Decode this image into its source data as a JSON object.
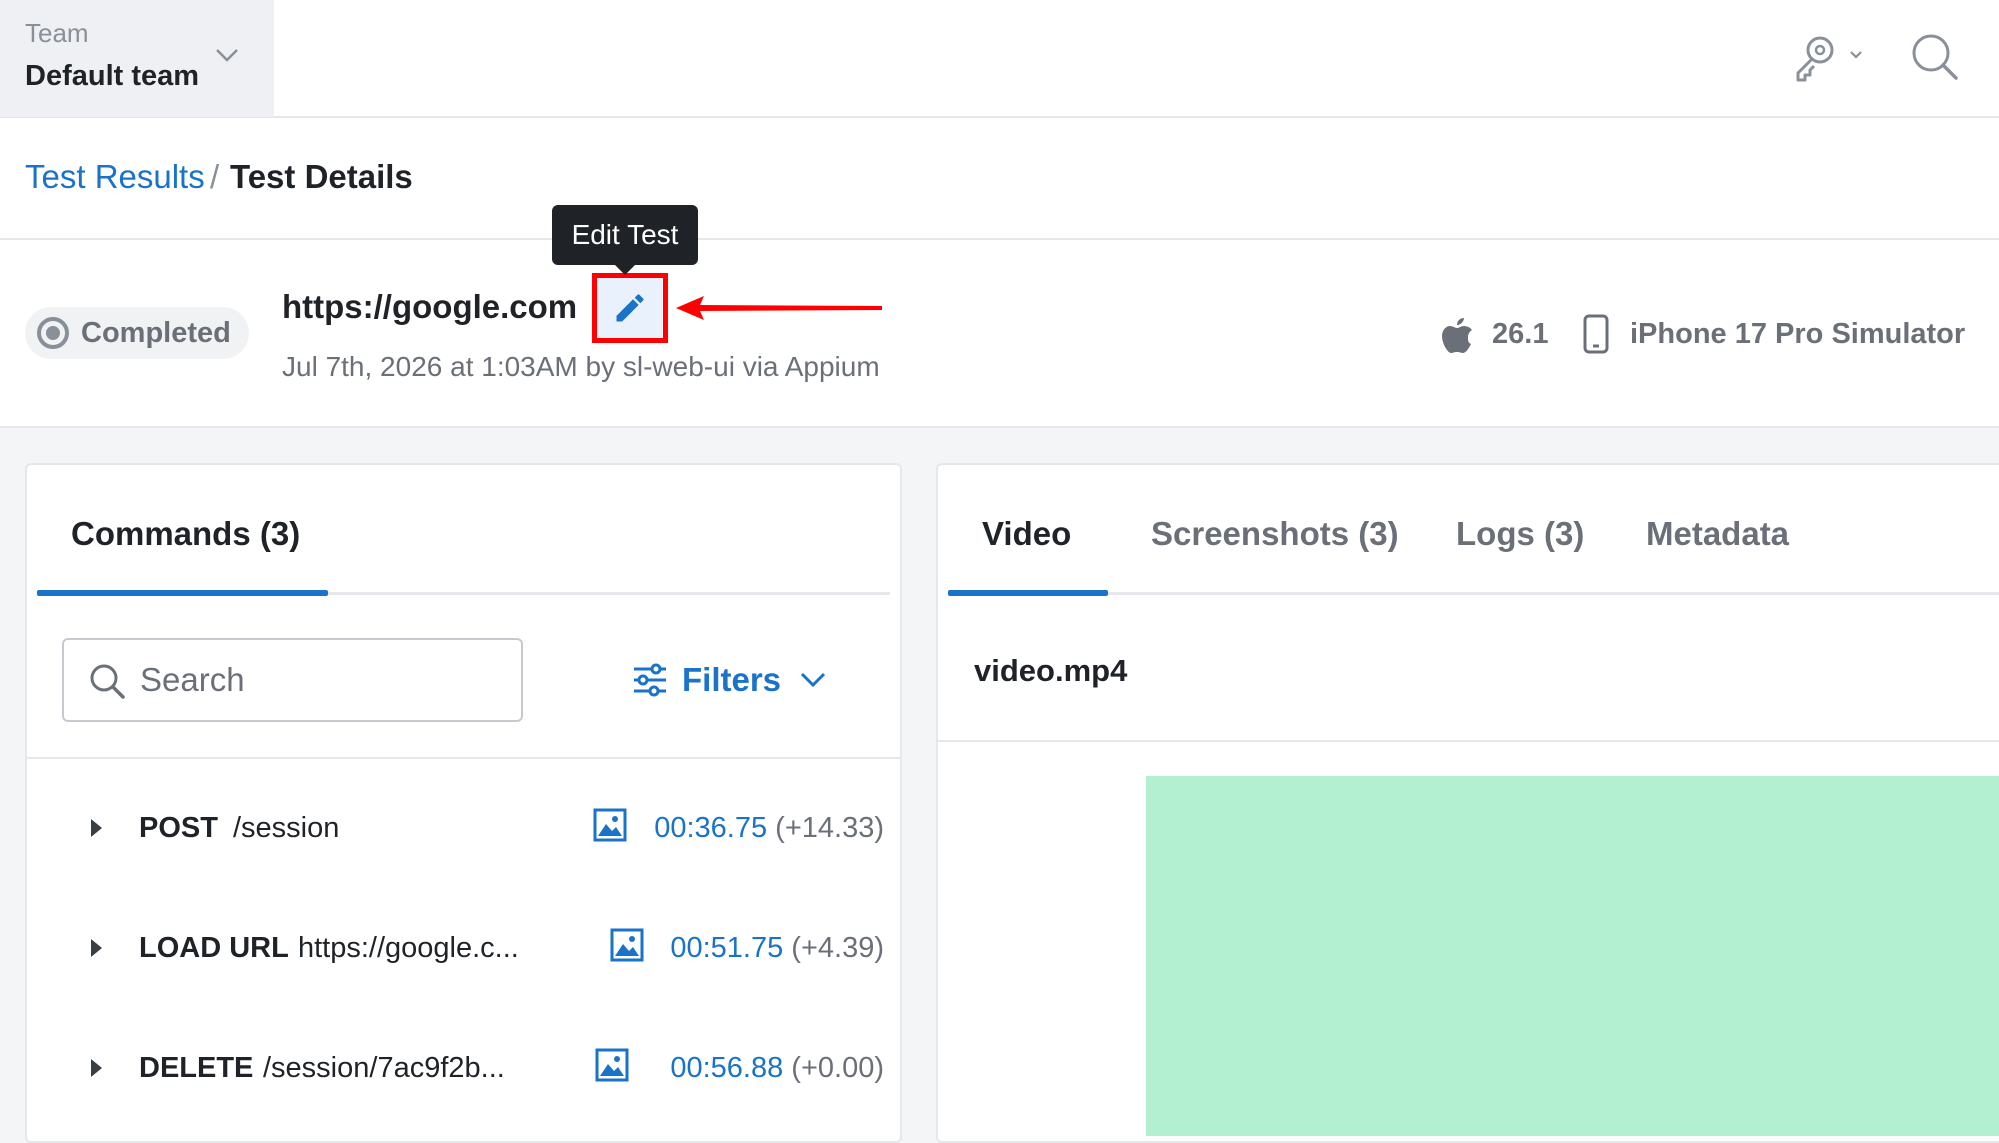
{
  "team": {
    "label": "Team",
    "name": "Default team"
  },
  "breadcrumb": {
    "parent": "Test Results",
    "separator": "/",
    "current": "Test Details"
  },
  "test": {
    "status": "Completed",
    "title": "https://google.com",
    "subtitle": "Jul 7th, 2026 at 1:03AM by sl-web-ui via Appium",
    "edit_tooltip": "Edit Test",
    "os_version": "26.1",
    "device": "iPhone 17 Pro Simulator"
  },
  "commands_panel": {
    "tab_label": "Commands (3)",
    "search_placeholder": "Search",
    "filters_label": "Filters",
    "rows": [
      {
        "method": "POST",
        "path": "/session",
        "time": "00:36.75",
        "delta": "(+14.33)"
      },
      {
        "method": "LOAD URL",
        "path": "https://google.c...",
        "time": "00:51.75",
        "delta": "(+4.39)"
      },
      {
        "method": "DELETE",
        "path": "/session/7ac9f2b...",
        "time": "00:56.88",
        "delta": "(+0.00)"
      }
    ]
  },
  "media_panel": {
    "tabs": [
      {
        "label": "Video"
      },
      {
        "label": "Screenshots (3)"
      },
      {
        "label": "Logs (3)"
      },
      {
        "label": "Metadata"
      }
    ],
    "active_tab": "Video",
    "file_name": "video.mp4"
  },
  "colors": {
    "accent": "#1a73c8",
    "annotation": "#ff0000",
    "video_placeholder": "#b3f0d2"
  },
  "icons": [
    "chevron-down-icon",
    "key-icon",
    "search-icon",
    "status-ring-icon",
    "pencil-icon",
    "apple-icon",
    "phone-icon",
    "filters-icon",
    "caret-right-icon",
    "image-icon"
  ]
}
